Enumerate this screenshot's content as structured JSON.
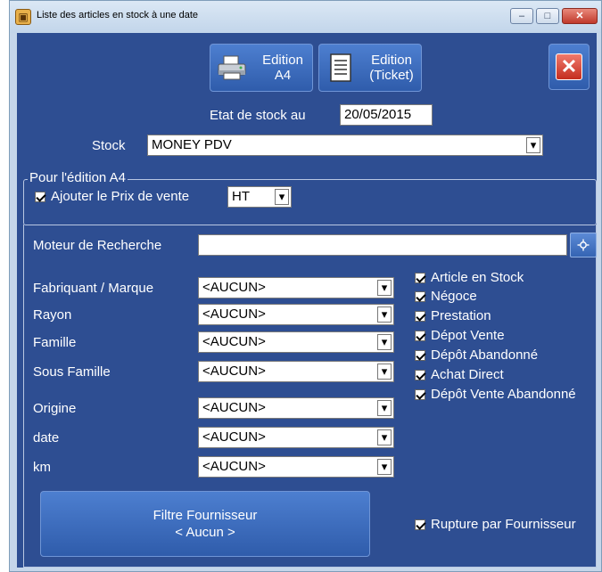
{
  "window": {
    "title": "Liste des articles en stock à une date",
    "controls": [
      "minimize",
      "maximize",
      "close"
    ]
  },
  "toolbar": {
    "edition_a4_label": "Edition\nA4",
    "edition_ticket_label": "Edition\n(Ticket)"
  },
  "stock_date": {
    "label": "Etat de stock au",
    "value": "20/05/2015"
  },
  "stock": {
    "label": "Stock",
    "value": "MONEY PDV"
  },
  "a4_group": {
    "title": "Pour l'édition A4",
    "add_price_label": "Ajouter le Prix de vente",
    "price_type": "HT"
  },
  "search": {
    "label": "Moteur de Recherche",
    "value": ""
  },
  "filters": [
    {
      "label": "Fabriquant / Marque",
      "value": "<AUCUN>"
    },
    {
      "label": "Rayon",
      "value": "<AUCUN>"
    },
    {
      "label": "Famille",
      "value": "<AUCUN>"
    },
    {
      "label": "Sous Famille",
      "value": "<AUCUN>"
    },
    {
      "label": "Origine",
      "value": "<AUCUN>"
    },
    {
      "label": "date",
      "value": "<AUCUN>"
    },
    {
      "label": "km",
      "value": "<AUCUN>"
    }
  ],
  "checkboxes": [
    {
      "label": "Article en Stock",
      "checked": true
    },
    {
      "label": "Négoce",
      "checked": true
    },
    {
      "label": "Prestation",
      "checked": true
    },
    {
      "label": "Dépot Vente",
      "checked": true
    },
    {
      "label": "Dépôt Abandonné",
      "checked": true
    },
    {
      "label": "Achat Direct",
      "checked": true
    },
    {
      "label": "Dépôt Vente Abandonné",
      "checked": true
    }
  ],
  "supplier_filter": {
    "line1": "Filtre Fournisseur",
    "line2": "< Aucun >"
  },
  "break_by_supplier": {
    "label": "Rupture par Fournisseur",
    "checked": true
  },
  "colors": {
    "panel_bg": "#2e4e92",
    "button_bg": "#3d6cc0",
    "close_red": "#c42d1f"
  }
}
